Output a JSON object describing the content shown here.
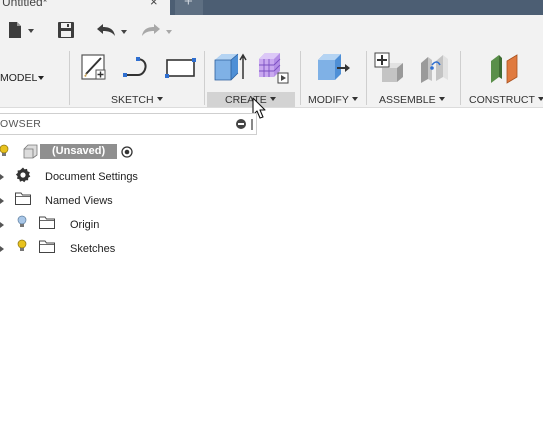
{
  "document": {
    "tab_title": "Untitled*",
    "close_glyph": "×",
    "new_tab_glyph": "+"
  },
  "quick_access": {
    "file_icon": "file-icon",
    "save_icon": "save-icon",
    "undo_icon": "undo-icon",
    "redo_icon": "redo-icon"
  },
  "workspace": {
    "label": "MODEL"
  },
  "ribbon": {
    "groups": [
      {
        "label": "SKETCH",
        "icons": [
          "create-sketch-icon",
          "arc-icon",
          "rectangle-icon"
        ]
      },
      {
        "label": "CREATE",
        "icons": [
          "extrude-icon",
          "create-form-icon"
        ]
      },
      {
        "label": "MODIFY",
        "icons": [
          "press-pull-icon"
        ]
      },
      {
        "label": "ASSEMBLE",
        "icons": [
          "new-component-icon",
          "joint-icon"
        ]
      },
      {
        "label": "CONSTRUCT",
        "icons": [
          "offset-plane-icon"
        ]
      }
    ],
    "hovered_group": "CREATE"
  },
  "browser": {
    "title": "OWSER",
    "root": {
      "label": "(Unsaved)"
    },
    "items": [
      {
        "label": "Document Settings",
        "icon": "gear-icon"
      },
      {
        "label": "Named Views",
        "icon": "folder-icon"
      },
      {
        "label": "Origin",
        "icon": "folder-icon",
        "visibility_icon": "lightbulb-off-icon"
      },
      {
        "label": "Sketches",
        "icon": "folder-icon",
        "visibility_icon": "lightbulb-on-icon"
      }
    ]
  },
  "colors": {
    "titlebar": "#4c5e73",
    "panel": "#f2f2f2",
    "bulb_on": "#e8c21e",
    "bulb_off": "#a9c7e8",
    "sketch_blue": "#2f6fd0",
    "form_purple": "#9b6fd9"
  }
}
